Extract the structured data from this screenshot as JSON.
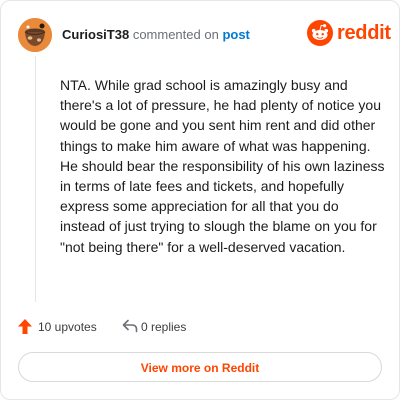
{
  "header": {
    "username": "CuriosiT38",
    "commented_text": "commented on",
    "post_link": "post",
    "brand_name": "reddit"
  },
  "comment": {
    "body": "NTA. While grad school is amazingly busy and there's a lot of pressure, he had plenty of notice you would be gone and you sent him rent and did other things to make him aware of what was happening. He should bear the responsibility of his own laziness in terms of late fees and tickets, and hopefully express some appreciation for all that you do instead of just trying to slough the blame on you for \"not being there\" for a well-deserved vacation."
  },
  "actions": {
    "upvotes": "10 upvotes",
    "replies": "0 replies"
  },
  "footer": {
    "view_button": "View more on Reddit"
  },
  "icons": {
    "avatar": "user-avatar",
    "brand": "reddit-alien-icon",
    "upvote": "upvote-arrow-icon",
    "reply": "reply-arrow-icon"
  },
  "colors": {
    "brand": "#ff4500",
    "link": "#0079d3",
    "avatar_bg": "#e98a3b"
  }
}
